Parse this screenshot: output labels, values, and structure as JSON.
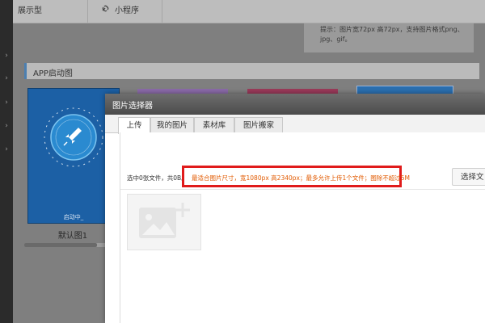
{
  "topbar": {
    "tab1_label": "展示型",
    "tab1_icon": "monitor-icon",
    "tab2_label": "小程序",
    "tab2_icon": "link-icon"
  },
  "background": {
    "hint_text": "提示：图片宽72px 高72px，支持图片格式png、jpg、gif。",
    "section_title": "APP启动图",
    "card_status": "启动中_",
    "default_label": "默认图1"
  },
  "dialog": {
    "title": "图片选择器",
    "tabs": [
      {
        "label": "上传",
        "active": true
      },
      {
        "label": "我的图片",
        "active": false
      },
      {
        "label": "素材库",
        "active": false
      },
      {
        "label": "图片搬家",
        "active": false
      }
    ],
    "selected_info": "选中0张文件，共0B。",
    "warning_text": "最适合图片尺寸，宽1080px 高2340px；最多允许上传1个文件；图除不超过5M",
    "choose_button_label": "选择文",
    "placeholder_icon": "image-add-icon"
  },
  "colors": {
    "accent_blue": "#4c7fb0",
    "warning_orange": "#e25a00",
    "highlight_red": "#e01b1b",
    "rocket_card_blue": "#1c60a5"
  }
}
